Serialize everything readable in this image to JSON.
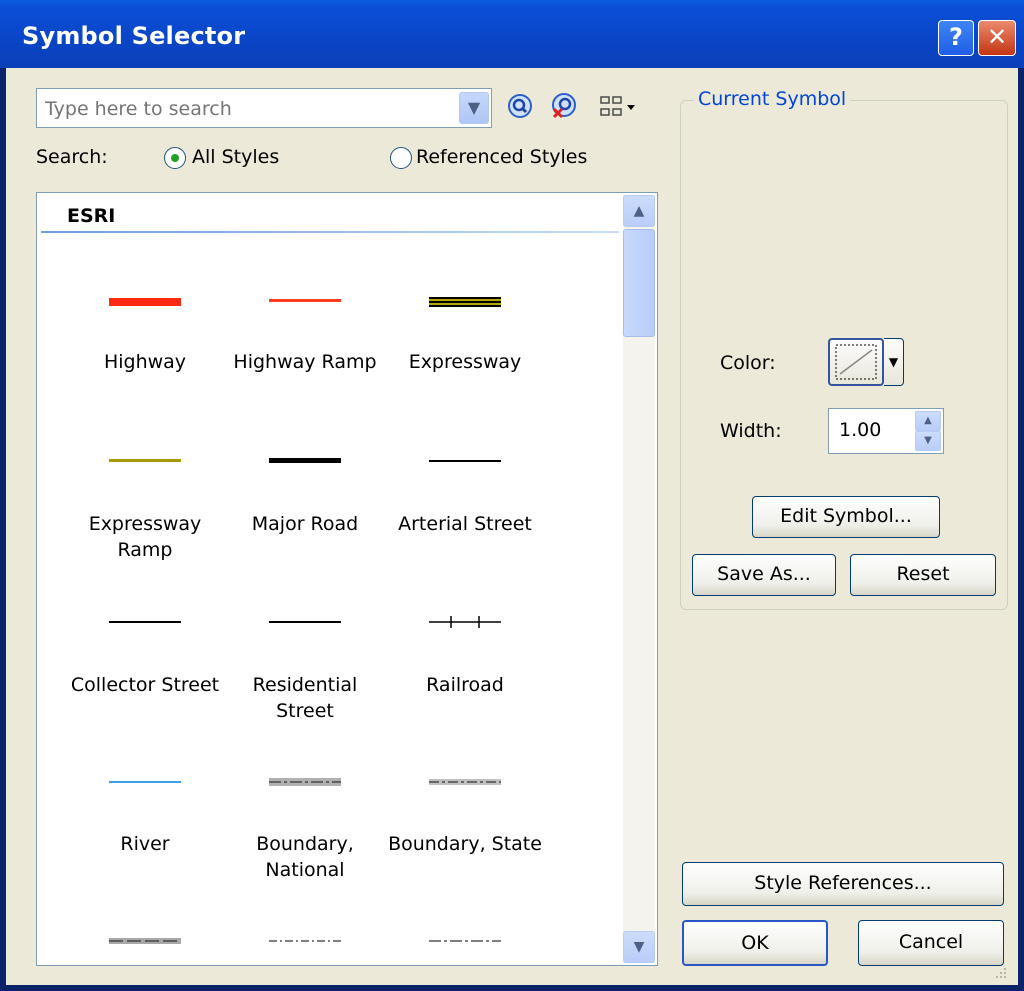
{
  "window": {
    "title": "Symbol Selector",
    "help_label": "?",
    "close_label": "✕"
  },
  "search": {
    "placeholder": "Type here to search",
    "search_label": "Search:",
    "option_all": "All Styles",
    "option_referenced": "Referenced Styles",
    "selected": "All Styles"
  },
  "list": {
    "group": "ESRI",
    "symbols": [
      {
        "label": "Highway",
        "icon": "thick-red-line",
        "color": "#ff2a12"
      },
      {
        "label": "Highway Ramp",
        "icon": "thin-red-line",
        "color": "#ff3b22"
      },
      {
        "label": "Expressway",
        "icon": "cased-olive-line",
        "color": "#b3a800"
      },
      {
        "label": "Expressway Ramp",
        "icon": "olive-line",
        "color": "#a89a00"
      },
      {
        "label": "Major Road",
        "icon": "thick-black-line",
        "color": "#000000"
      },
      {
        "label": "Arterial Street",
        "icon": "black-line",
        "color": "#000000"
      },
      {
        "label": "Collector Street",
        "icon": "black-line",
        "color": "#000000"
      },
      {
        "label": "Residential Street",
        "icon": "black-line",
        "color": "#000000"
      },
      {
        "label": "Railroad",
        "icon": "railroad-line",
        "color": "#000000"
      },
      {
        "label": "River",
        "icon": "blue-line",
        "color": "#3a9ff0"
      },
      {
        "label": "Boundary, National",
        "icon": "gray-dash-dot-line",
        "color": "#a0a0a0"
      },
      {
        "label": "Boundary, State",
        "icon": "gray-dash-dot-line",
        "color": "#a0a0a0"
      }
    ]
  },
  "current_symbol": {
    "title": "Current Symbol",
    "color_label": "Color:",
    "width_label": "Width:",
    "width_value": "1.00",
    "edit_symbol": "Edit Symbol...",
    "save_as": "Save As...",
    "reset": "Reset"
  },
  "buttons": {
    "style_references": "Style References...",
    "ok": "OK",
    "cancel": "Cancel"
  }
}
